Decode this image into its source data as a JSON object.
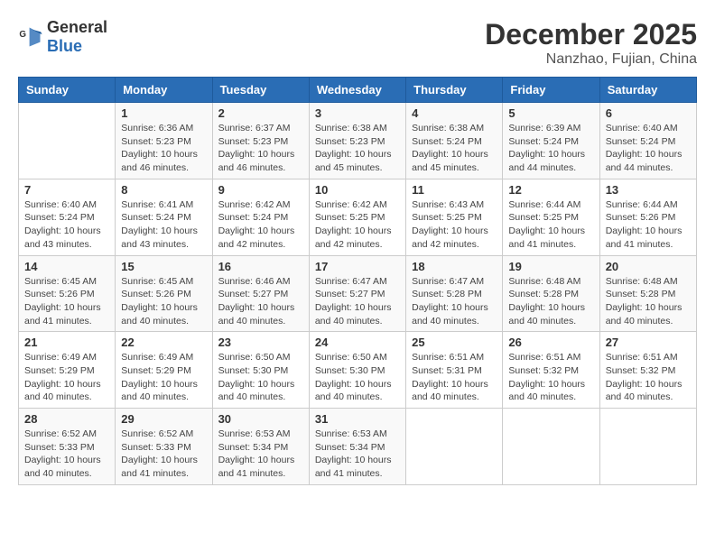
{
  "header": {
    "logo_general": "General",
    "logo_blue": "Blue",
    "month_year": "December 2025",
    "location": "Nanzhao, Fujian, China"
  },
  "weekdays": [
    "Sunday",
    "Monday",
    "Tuesday",
    "Wednesday",
    "Thursday",
    "Friday",
    "Saturday"
  ],
  "weeks": [
    [
      {
        "day": "",
        "info": ""
      },
      {
        "day": "1",
        "info": "Sunrise: 6:36 AM\nSunset: 5:23 PM\nDaylight: 10 hours\nand 46 minutes."
      },
      {
        "day": "2",
        "info": "Sunrise: 6:37 AM\nSunset: 5:23 PM\nDaylight: 10 hours\nand 46 minutes."
      },
      {
        "day": "3",
        "info": "Sunrise: 6:38 AM\nSunset: 5:23 PM\nDaylight: 10 hours\nand 45 minutes."
      },
      {
        "day": "4",
        "info": "Sunrise: 6:38 AM\nSunset: 5:24 PM\nDaylight: 10 hours\nand 45 minutes."
      },
      {
        "day": "5",
        "info": "Sunrise: 6:39 AM\nSunset: 5:24 PM\nDaylight: 10 hours\nand 44 minutes."
      },
      {
        "day": "6",
        "info": "Sunrise: 6:40 AM\nSunset: 5:24 PM\nDaylight: 10 hours\nand 44 minutes."
      }
    ],
    [
      {
        "day": "7",
        "info": "Sunrise: 6:40 AM\nSunset: 5:24 PM\nDaylight: 10 hours\nand 43 minutes."
      },
      {
        "day": "8",
        "info": "Sunrise: 6:41 AM\nSunset: 5:24 PM\nDaylight: 10 hours\nand 43 minutes."
      },
      {
        "day": "9",
        "info": "Sunrise: 6:42 AM\nSunset: 5:24 PM\nDaylight: 10 hours\nand 42 minutes."
      },
      {
        "day": "10",
        "info": "Sunrise: 6:42 AM\nSunset: 5:25 PM\nDaylight: 10 hours\nand 42 minutes."
      },
      {
        "day": "11",
        "info": "Sunrise: 6:43 AM\nSunset: 5:25 PM\nDaylight: 10 hours\nand 42 minutes."
      },
      {
        "day": "12",
        "info": "Sunrise: 6:44 AM\nSunset: 5:25 PM\nDaylight: 10 hours\nand 41 minutes."
      },
      {
        "day": "13",
        "info": "Sunrise: 6:44 AM\nSunset: 5:26 PM\nDaylight: 10 hours\nand 41 minutes."
      }
    ],
    [
      {
        "day": "14",
        "info": "Sunrise: 6:45 AM\nSunset: 5:26 PM\nDaylight: 10 hours\nand 41 minutes."
      },
      {
        "day": "15",
        "info": "Sunrise: 6:45 AM\nSunset: 5:26 PM\nDaylight: 10 hours\nand 40 minutes."
      },
      {
        "day": "16",
        "info": "Sunrise: 6:46 AM\nSunset: 5:27 PM\nDaylight: 10 hours\nand 40 minutes."
      },
      {
        "day": "17",
        "info": "Sunrise: 6:47 AM\nSunset: 5:27 PM\nDaylight: 10 hours\nand 40 minutes."
      },
      {
        "day": "18",
        "info": "Sunrise: 6:47 AM\nSunset: 5:28 PM\nDaylight: 10 hours\nand 40 minutes."
      },
      {
        "day": "19",
        "info": "Sunrise: 6:48 AM\nSunset: 5:28 PM\nDaylight: 10 hours\nand 40 minutes."
      },
      {
        "day": "20",
        "info": "Sunrise: 6:48 AM\nSunset: 5:28 PM\nDaylight: 10 hours\nand 40 minutes."
      }
    ],
    [
      {
        "day": "21",
        "info": "Sunrise: 6:49 AM\nSunset: 5:29 PM\nDaylight: 10 hours\nand 40 minutes."
      },
      {
        "day": "22",
        "info": "Sunrise: 6:49 AM\nSunset: 5:29 PM\nDaylight: 10 hours\nand 40 minutes."
      },
      {
        "day": "23",
        "info": "Sunrise: 6:50 AM\nSunset: 5:30 PM\nDaylight: 10 hours\nand 40 minutes."
      },
      {
        "day": "24",
        "info": "Sunrise: 6:50 AM\nSunset: 5:30 PM\nDaylight: 10 hours\nand 40 minutes."
      },
      {
        "day": "25",
        "info": "Sunrise: 6:51 AM\nSunset: 5:31 PM\nDaylight: 10 hours\nand 40 minutes."
      },
      {
        "day": "26",
        "info": "Sunrise: 6:51 AM\nSunset: 5:32 PM\nDaylight: 10 hours\nand 40 minutes."
      },
      {
        "day": "27",
        "info": "Sunrise: 6:51 AM\nSunset: 5:32 PM\nDaylight: 10 hours\nand 40 minutes."
      }
    ],
    [
      {
        "day": "28",
        "info": "Sunrise: 6:52 AM\nSunset: 5:33 PM\nDaylight: 10 hours\nand 40 minutes."
      },
      {
        "day": "29",
        "info": "Sunrise: 6:52 AM\nSunset: 5:33 PM\nDaylight: 10 hours\nand 41 minutes."
      },
      {
        "day": "30",
        "info": "Sunrise: 6:53 AM\nSunset: 5:34 PM\nDaylight: 10 hours\nand 41 minutes."
      },
      {
        "day": "31",
        "info": "Sunrise: 6:53 AM\nSunset: 5:34 PM\nDaylight: 10 hours\nand 41 minutes."
      },
      {
        "day": "",
        "info": ""
      },
      {
        "day": "",
        "info": ""
      },
      {
        "day": "",
        "info": ""
      }
    ]
  ]
}
